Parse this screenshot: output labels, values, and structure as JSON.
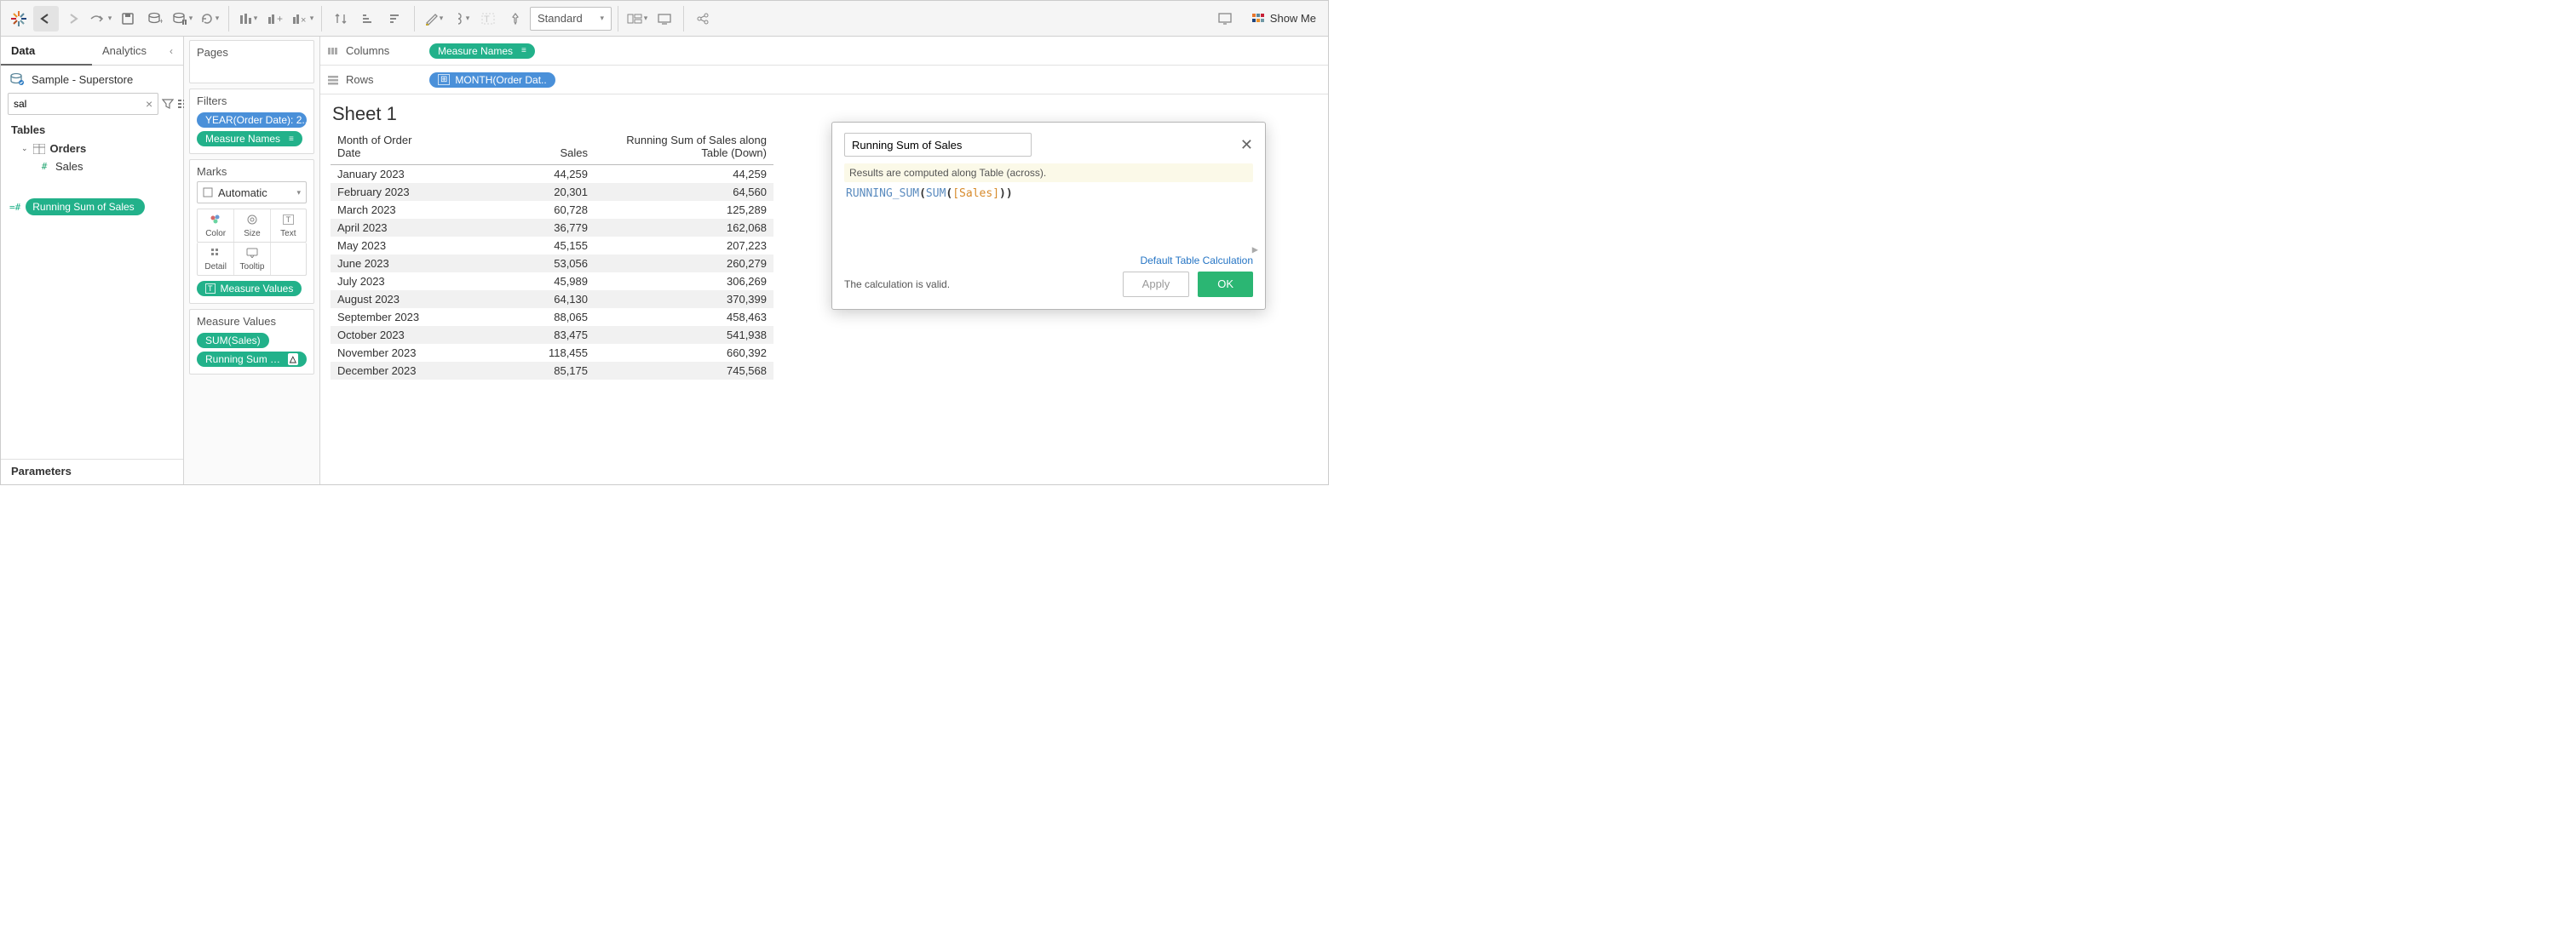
{
  "toolbar": {
    "fit_mode": "Standard",
    "showme": "Show Me"
  },
  "leftnav": {
    "tab_data": "Data",
    "tab_analytics": "Analytics",
    "datasource": "Sample - Superstore",
    "search_value": "sal",
    "tables_header": "Tables",
    "orders_label": "Orders",
    "sales_label": "Sales",
    "calc_field": "Running Sum of Sales",
    "parameters_header": "Parameters"
  },
  "shelves": {
    "pages_header": "Pages",
    "filters_header": "Filters",
    "filter_year": "YEAR(Order Date): 2..",
    "filter_measure_names": "Measure Names",
    "marks_header": "Marks",
    "marks_type": "Automatic",
    "marks_labels": {
      "color": "Color",
      "size": "Size",
      "text": "Text",
      "detail": "Detail",
      "tooltip": "Tooltip"
    },
    "measure_values_header": "Measure Values",
    "mv_items": [
      "SUM(Sales)",
      "Running Sum of S.."
    ],
    "measure_values_pill": "Measure Values"
  },
  "columns_rows": {
    "columns_label": "Columns",
    "rows_label": "Rows",
    "columns_pill": "Measure Names",
    "rows_pill": "MONTH(Order Dat.."
  },
  "viz": {
    "sheet_title": "Sheet 1",
    "col_month": "Month of Order\nDate",
    "col_sales": "Sales",
    "col_running": "Running Sum of Sales along\nTable (Down)",
    "rows": [
      {
        "m": "January 2023",
        "s": "44,259",
        "r": "44,259"
      },
      {
        "m": "February 2023",
        "s": "20,301",
        "r": "64,560"
      },
      {
        "m": "March 2023",
        "s": "60,728",
        "r": "125,289"
      },
      {
        "m": "April 2023",
        "s": "36,779",
        "r": "162,068"
      },
      {
        "m": "May 2023",
        "s": "45,155",
        "r": "207,223"
      },
      {
        "m": "June 2023",
        "s": "53,056",
        "r": "260,279"
      },
      {
        "m": "July 2023",
        "s": "45,989",
        "r": "306,269"
      },
      {
        "m": "August 2023",
        "s": "64,130",
        "r": "370,399"
      },
      {
        "m": "September 2023",
        "s": "88,065",
        "r": "458,463"
      },
      {
        "m": "October 2023",
        "s": "83,475",
        "r": "541,938"
      },
      {
        "m": "November 2023",
        "s": "118,455",
        "r": "660,392"
      },
      {
        "m": "December 2023",
        "s": "85,175",
        "r": "745,568"
      }
    ]
  },
  "calc": {
    "name": "Running Sum of Sales",
    "info": "Results are computed along Table (across).",
    "fn1": "RUNNING_SUM",
    "fn2": "SUM",
    "field": "[Sales]",
    "valid": "The calculation is valid.",
    "link": "Default Table Calculation",
    "apply": "Apply",
    "ok": "OK"
  }
}
